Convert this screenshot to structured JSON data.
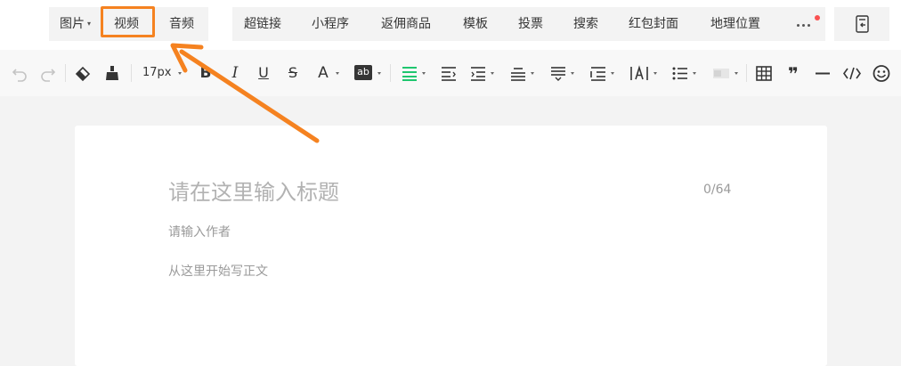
{
  "media_tabs": {
    "image": "图片",
    "video": "视频",
    "audio": "音频"
  },
  "insert_tabs": [
    "超链接",
    "小程序",
    "返佣商品",
    "模板",
    "投票",
    "搜索",
    "红包封面",
    "地理位置"
  ],
  "more_label": "···",
  "toolbar": {
    "font_size": "17px",
    "icons": [
      "undo-icon",
      "redo-icon",
      "eraser-icon",
      "format-brush-icon",
      "bold-icon",
      "italic-icon",
      "underline-icon",
      "strikethrough-icon",
      "font-color-icon",
      "highlight-icon",
      "align-icon",
      "indent-icon",
      "text-indent-icon",
      "line-height-icon",
      "paragraph-spacing-icon",
      "page-margin-icon",
      "letter-spacing-icon",
      "list-icon",
      "text-bg-icon",
      "table-icon",
      "quote-icon",
      "divider-icon",
      "code-icon",
      "emoji-icon"
    ],
    "bold_glyph": "B",
    "italic_glyph": "I",
    "underline_glyph": "U",
    "strike_glyph": "S",
    "color_glyph": "A",
    "bg_glyph": "ab",
    "quote_glyph": "❞"
  },
  "editor": {
    "title_placeholder": "请在这里输入标题",
    "title_count": "0/64",
    "author_placeholder": "请输入作者",
    "body_placeholder": "从这里开始写正文"
  },
  "colors": {
    "accent_green": "#07c160",
    "annotation_orange": "#f58220",
    "notification_red": "#fa5151"
  }
}
